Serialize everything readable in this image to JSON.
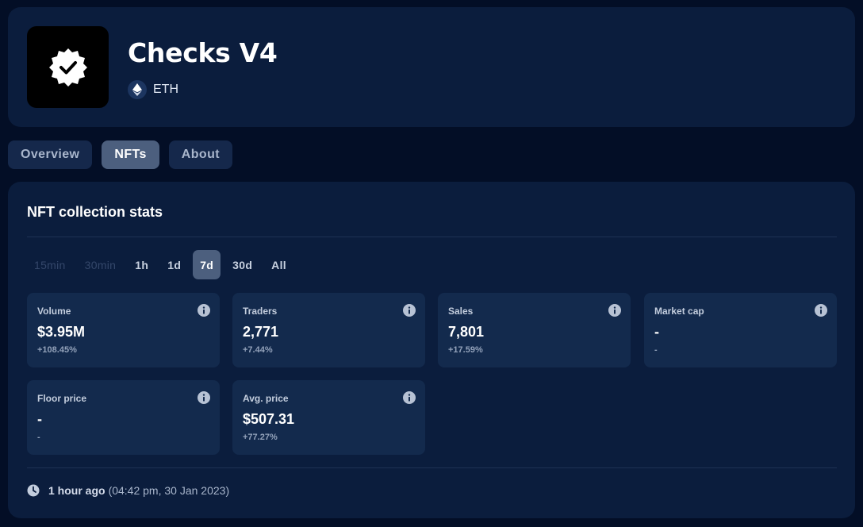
{
  "collection": {
    "name": "Checks V4",
    "chain": "ETH",
    "logo_icon": "verified-check-badge-icon",
    "chain_icon": "ethereum-icon"
  },
  "tabs": [
    {
      "label": "Overview",
      "active": false
    },
    {
      "label": "NFTs",
      "active": true
    },
    {
      "label": "About",
      "active": false
    }
  ],
  "stats": {
    "title": "NFT collection stats",
    "periods": [
      {
        "label": "15min",
        "state": "disabled"
      },
      {
        "label": "30min",
        "state": "disabled"
      },
      {
        "label": "1h",
        "state": "enabled"
      },
      {
        "label": "1d",
        "state": "enabled"
      },
      {
        "label": "7d",
        "state": "active"
      },
      {
        "label": "30d",
        "state": "enabled"
      },
      {
        "label": "All",
        "state": "enabled"
      }
    ],
    "cards": [
      {
        "label": "Volume",
        "value": "$3.95M",
        "change": "+108.45%"
      },
      {
        "label": "Traders",
        "value": "2,771",
        "change": "+7.44%"
      },
      {
        "label": "Sales",
        "value": "7,801",
        "change": "+17.59%"
      },
      {
        "label": "Market cap",
        "value": "-",
        "change": "-"
      },
      {
        "label": "Floor price",
        "value": "-",
        "change": "-"
      },
      {
        "label": "Avg. price",
        "value": "$507.31",
        "change": "+77.27%"
      }
    ],
    "updated_ago": "1 hour ago",
    "updated_time": "(04:42 pm, 30 Jan 2023)"
  },
  "colors": {
    "background": "#030e26",
    "card": "#0b1d3d",
    "stat_card": "#132a4d",
    "active": "#4c5f7e"
  }
}
